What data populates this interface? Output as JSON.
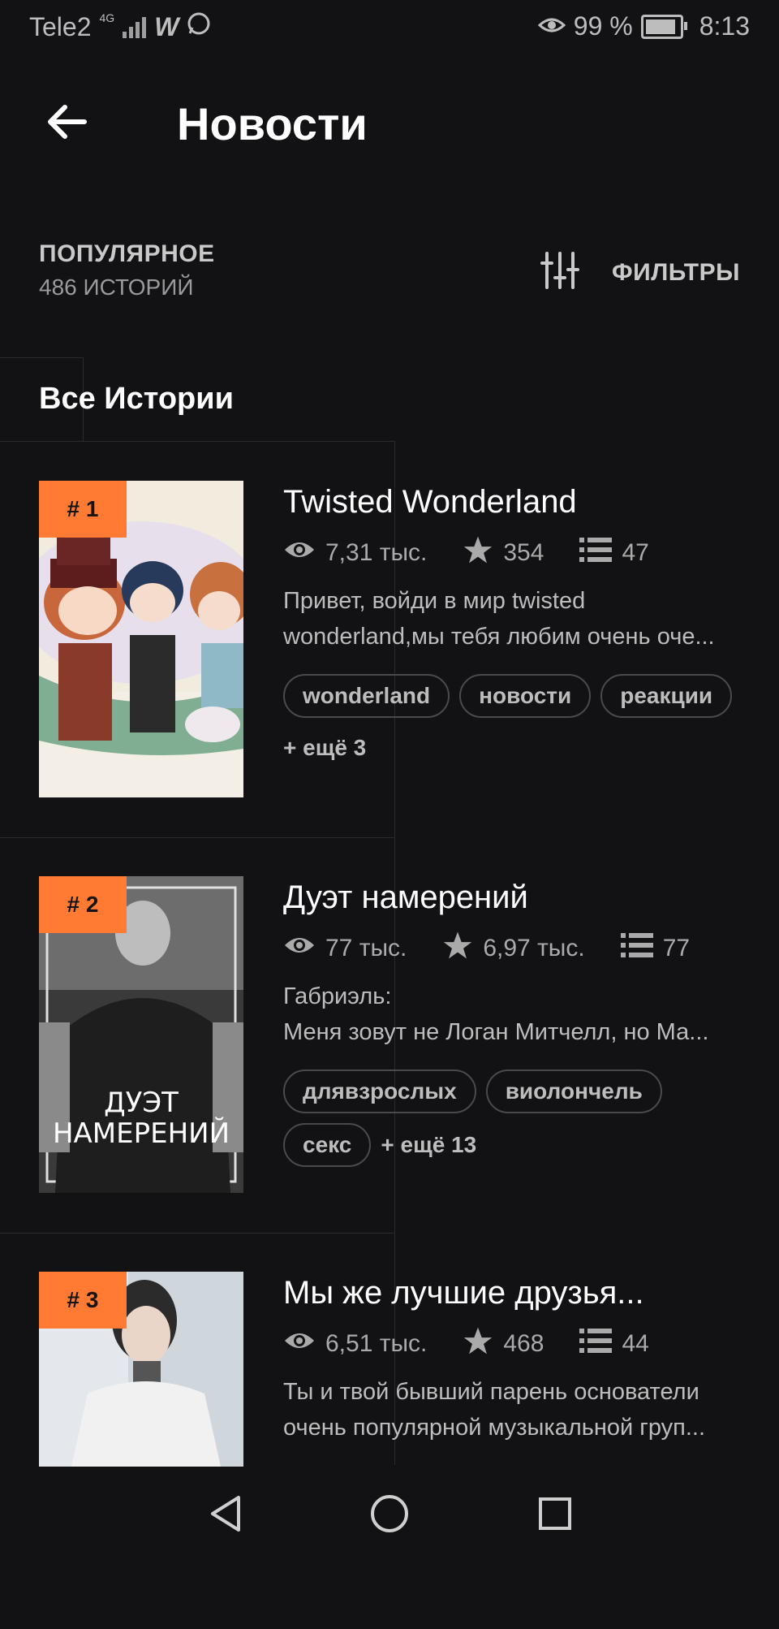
{
  "status": {
    "carrier": "Tele2",
    "network": "4G",
    "battery": "99 %",
    "time": "8:13"
  },
  "header": {
    "title": "Новости"
  },
  "section": {
    "title": "ПОПУЛЯРНОЕ",
    "count": "486 ИСТОРИЙ",
    "filters_label": "ФИЛЬТРЫ"
  },
  "tab": {
    "label": "Все Истории"
  },
  "colors": {
    "accent": "#ff7a33",
    "background": "#121114"
  },
  "stories": [
    {
      "rank": "# 1",
      "title": "Twisted Wonderland",
      "views": "7,31 тыс.",
      "votes": "354",
      "parts": "47",
      "desc_line1": "Привет, войди в мир twisted",
      "desc_line2": "wonderland,мы тебя любим очень оче...",
      "tags": [
        "wonderland",
        "новости",
        "реакции"
      ],
      "more": "+ ещё 3"
    },
    {
      "rank": "# 2",
      "title": "Дуэт намерений",
      "views": "77 тыс.",
      "votes": "6,97 тыс.",
      "parts": "77",
      "desc_line1": "Габриэль:",
      "desc_line2": "Меня зовут не Логан Митчелл, но Ма...",
      "tags": [
        "длявзрослых",
        "виолончель",
        "секс"
      ],
      "more": "+ ещё 13",
      "cover_text_1": "ДУЭТ",
      "cover_text_2": "НАМЕРЕНИЙ"
    },
    {
      "rank": "# 3",
      "title": "Мы же лучшие друзья...",
      "views": "6,51 тыс.",
      "votes": "468",
      "parts": "44",
      "desc_line1": "Ты и твой бывший парень основатели",
      "desc_line2": "очень популярной музыкальной груп..."
    }
  ]
}
